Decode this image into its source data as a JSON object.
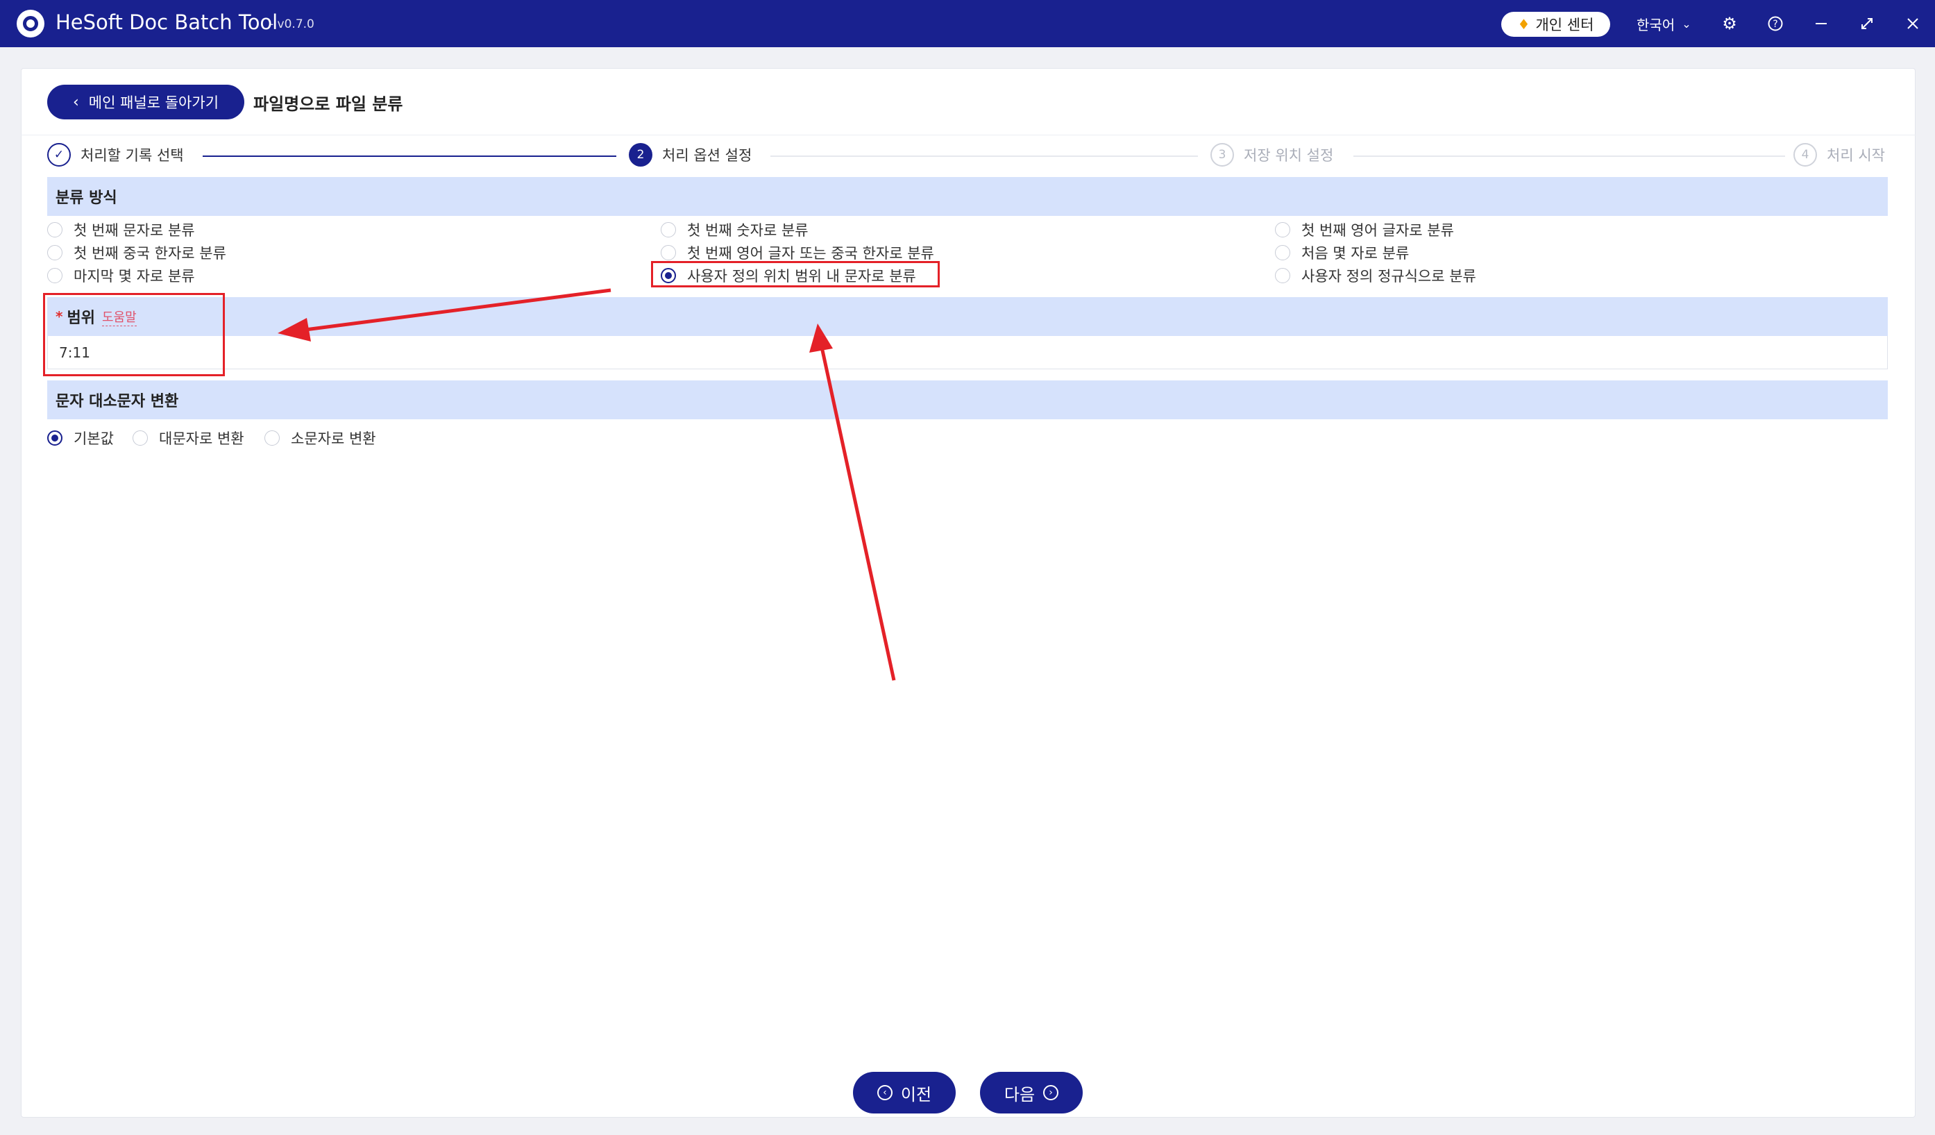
{
  "titlebar": {
    "app_name": "HeSoft Doc Batch Tool",
    "version": "- v0.7.0",
    "center_label": "개인 센터",
    "language": "한국어"
  },
  "header": {
    "back_label": "메인 패널로 돌아가기",
    "page_title": "파일명으로 파일 분류"
  },
  "steps": [
    {
      "num": "✓",
      "label": "처리할 기록 선택"
    },
    {
      "num": "2",
      "label": "처리 옵션 설정"
    },
    {
      "num": "3",
      "label": "저장 위치 설정"
    },
    {
      "num": "4",
      "label": "처리 시작"
    }
  ],
  "classify": {
    "title": "분류 방식",
    "options": [
      "첫 번째 문자로 분류",
      "첫 번째 숫자로 분류",
      "첫 번째 영어 글자로 분류",
      "첫 번째 중국 한자로 분류",
      "첫 번째 영어 글자 또는 중국 한자로 분류",
      "처음 몇 자로 분류",
      "마지막 몇 자로 분류",
      "사용자 정의 위치 범위 내 문자로 분류",
      "사용자 정의 정규식으로 분류"
    ],
    "selected": "사용자 정의 위치 범위 내 문자로 분류"
  },
  "range": {
    "required_mark": "*",
    "label": "범위",
    "help": "도움말",
    "value": "7:11"
  },
  "case": {
    "title": "문자 대소문자 변환",
    "options": [
      "기본값",
      "대문자로 변환",
      "소문자로 변환"
    ],
    "selected": "기본값"
  },
  "nav": {
    "prev_label": "이전",
    "next_label": "다음"
  },
  "colors": {
    "primary": "#19218f",
    "section_bg": "#d6e2fc",
    "annotation": "#e42128"
  }
}
